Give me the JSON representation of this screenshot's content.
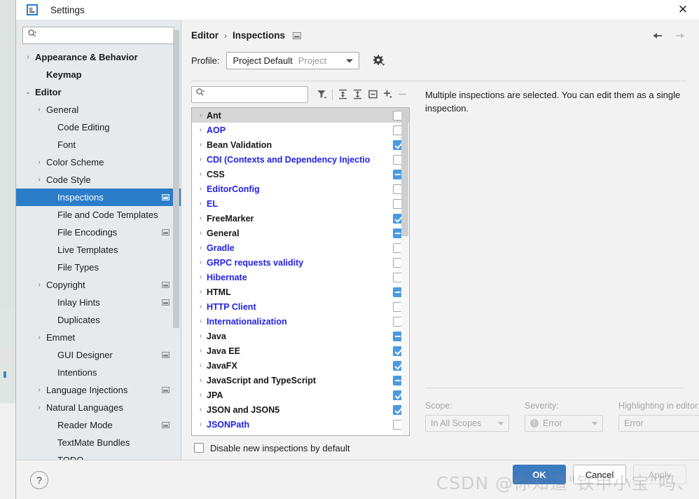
{
  "window": {
    "title": "Settings",
    "app_icon": "intellij-idea-icon",
    "close_label": "✕"
  },
  "sidebar": {
    "search": {
      "value": "",
      "placeholder": "",
      "icon": "search-icon"
    },
    "items": [
      {
        "label": "Appearance & Behavior",
        "twisty": "›",
        "bold": true,
        "indent": 0,
        "badge": false,
        "selected": false
      },
      {
        "label": "Keymap",
        "twisty": "",
        "bold": true,
        "indent": 1,
        "badge": false,
        "selected": false
      },
      {
        "label": "Editor",
        "twisty": "⌄",
        "bold": true,
        "indent": 0,
        "badge": false,
        "selected": false
      },
      {
        "label": "General",
        "twisty": "›",
        "bold": false,
        "indent": 1,
        "badge": false,
        "selected": false
      },
      {
        "label": "Code Editing",
        "twisty": "",
        "bold": false,
        "indent": 2,
        "badge": false,
        "selected": false
      },
      {
        "label": "Font",
        "twisty": "",
        "bold": false,
        "indent": 2,
        "badge": false,
        "selected": false
      },
      {
        "label": "Color Scheme",
        "twisty": "›",
        "bold": false,
        "indent": 1,
        "badge": false,
        "selected": false
      },
      {
        "label": "Code Style",
        "twisty": "›",
        "bold": false,
        "indent": 1,
        "badge": false,
        "selected": false
      },
      {
        "label": "Inspections",
        "twisty": "",
        "bold": false,
        "indent": 2,
        "badge": true,
        "selected": true
      },
      {
        "label": "File and Code Templates",
        "twisty": "",
        "bold": false,
        "indent": 2,
        "badge": false,
        "selected": false
      },
      {
        "label": "File Encodings",
        "twisty": "",
        "bold": false,
        "indent": 2,
        "badge": true,
        "selected": false
      },
      {
        "label": "Live Templates",
        "twisty": "",
        "bold": false,
        "indent": 2,
        "badge": false,
        "selected": false
      },
      {
        "label": "File Types",
        "twisty": "",
        "bold": false,
        "indent": 2,
        "badge": false,
        "selected": false
      },
      {
        "label": "Copyright",
        "twisty": "›",
        "bold": false,
        "indent": 1,
        "badge": true,
        "selected": false
      },
      {
        "label": "Inlay Hints",
        "twisty": "",
        "bold": false,
        "indent": 2,
        "badge": true,
        "selected": false
      },
      {
        "label": "Duplicates",
        "twisty": "",
        "bold": false,
        "indent": 2,
        "badge": false,
        "selected": false
      },
      {
        "label": "Emmet",
        "twisty": "›",
        "bold": false,
        "indent": 1,
        "badge": false,
        "selected": false
      },
      {
        "label": "GUI Designer",
        "twisty": "",
        "bold": false,
        "indent": 2,
        "badge": true,
        "selected": false
      },
      {
        "label": "Intentions",
        "twisty": "",
        "bold": false,
        "indent": 2,
        "badge": false,
        "selected": false
      },
      {
        "label": "Language Injections",
        "twisty": "›",
        "bold": false,
        "indent": 1,
        "badge": true,
        "selected": false
      },
      {
        "label": "Natural Languages",
        "twisty": "›",
        "bold": false,
        "indent": 1,
        "badge": false,
        "selected": false
      },
      {
        "label": "Reader Mode",
        "twisty": "",
        "bold": false,
        "indent": 2,
        "badge": true,
        "selected": false
      },
      {
        "label": "TextMate Bundles",
        "twisty": "",
        "bold": false,
        "indent": 2,
        "badge": false,
        "selected": false
      },
      {
        "label": "TODO",
        "twisty": "",
        "bold": false,
        "indent": 2,
        "badge": false,
        "selected": false
      }
    ]
  },
  "breadcrumb": {
    "parent": "Editor",
    "separator": "›",
    "current": "Inspections",
    "badge_icon": "project-scope-badge-icon"
  },
  "nav": {
    "back_icon": "arrow-left-icon",
    "forward_icon": "arrow-right-icon"
  },
  "profile": {
    "label": "Profile:",
    "value": "Project Default",
    "scope_suffix": "Project",
    "gear_icon": "gear-icon"
  },
  "list_toolbar": {
    "filter_search": {
      "value": "",
      "placeholder": "",
      "icon": "search-icon"
    },
    "buttons": [
      {
        "name": "filter-icon",
        "title": "Filter"
      },
      {
        "name": "expand-all-icon",
        "title": "Expand All"
      },
      {
        "name": "collapse-all-icon",
        "title": "Collapse All"
      },
      {
        "name": "reset-to-default-icon",
        "title": "Reset"
      },
      {
        "name": "add-icon",
        "title": "Add"
      },
      {
        "name": "remove-icon",
        "title": "Remove"
      }
    ]
  },
  "inspections": {
    "rows": [
      {
        "label": "Ant",
        "color": "black",
        "state": "off",
        "selected": true
      },
      {
        "label": "AOP",
        "color": "blue",
        "state": "off",
        "selected": false
      },
      {
        "label": "Bean Validation",
        "color": "black",
        "state": "on",
        "selected": false
      },
      {
        "label": "CDI (Contexts and Dependency Injectio",
        "color": "blue",
        "state": "off",
        "selected": false
      },
      {
        "label": "CSS",
        "color": "black",
        "state": "mixed",
        "selected": false
      },
      {
        "label": "EditorConfig",
        "color": "blue",
        "state": "off",
        "selected": false
      },
      {
        "label": "EL",
        "color": "blue",
        "state": "off",
        "selected": false
      },
      {
        "label": "FreeMarker",
        "color": "black",
        "state": "on",
        "selected": false
      },
      {
        "label": "General",
        "color": "black",
        "state": "mixed",
        "selected": false
      },
      {
        "label": "Gradle",
        "color": "blue",
        "state": "off",
        "selected": false
      },
      {
        "label": "GRPC requests validity",
        "color": "blue",
        "state": "off",
        "selected": false
      },
      {
        "label": "Hibernate",
        "color": "blue",
        "state": "off",
        "selected": false
      },
      {
        "label": "HTML",
        "color": "black",
        "state": "mixed",
        "selected": false
      },
      {
        "label": "HTTP Client",
        "color": "blue",
        "state": "off",
        "selected": false
      },
      {
        "label": "Internationalization",
        "color": "blue",
        "state": "off",
        "selected": false
      },
      {
        "label": "Java",
        "color": "black",
        "state": "mixed",
        "selected": false
      },
      {
        "label": "Java EE",
        "color": "black",
        "state": "on",
        "selected": false
      },
      {
        "label": "JavaFX",
        "color": "black",
        "state": "on",
        "selected": false
      },
      {
        "label": "JavaScript and TypeScript",
        "color": "black",
        "state": "mixed",
        "selected": false
      },
      {
        "label": "JPA",
        "color": "black",
        "state": "on",
        "selected": false
      },
      {
        "label": "JSON and JSON5",
        "color": "black",
        "state": "on",
        "selected": false
      },
      {
        "label": "JSONPath",
        "color": "blue",
        "state": "off",
        "selected": false
      }
    ]
  },
  "disable_new": {
    "label": "Disable new inspections by default",
    "checked": false
  },
  "description": {
    "text": "Multiple inspections are selected. You can edit them as a single inspection."
  },
  "options": {
    "scope": {
      "caption": "Scope:",
      "value": "In All Scopes"
    },
    "severity": {
      "caption": "Severity:",
      "value": "Error",
      "icon": "severity-error-icon"
    },
    "highlighting": {
      "caption": "Highlighting in editor:",
      "value": "Error"
    }
  },
  "footer": {
    "help_label": "?",
    "ok_label": "OK",
    "cancel_label": "Cancel",
    "apply_label": "Apply"
  },
  "watermark": {
    "text": "CSDN @你知道\"铁甲小宝\"吗、"
  },
  "colors": {
    "accent": "#2a7dc9",
    "primary_button": "#3d7bbf",
    "checkbox_on": "#4a9ae0",
    "disabled_text": "#a7a7a7",
    "plugin_link": "#2121e8"
  }
}
